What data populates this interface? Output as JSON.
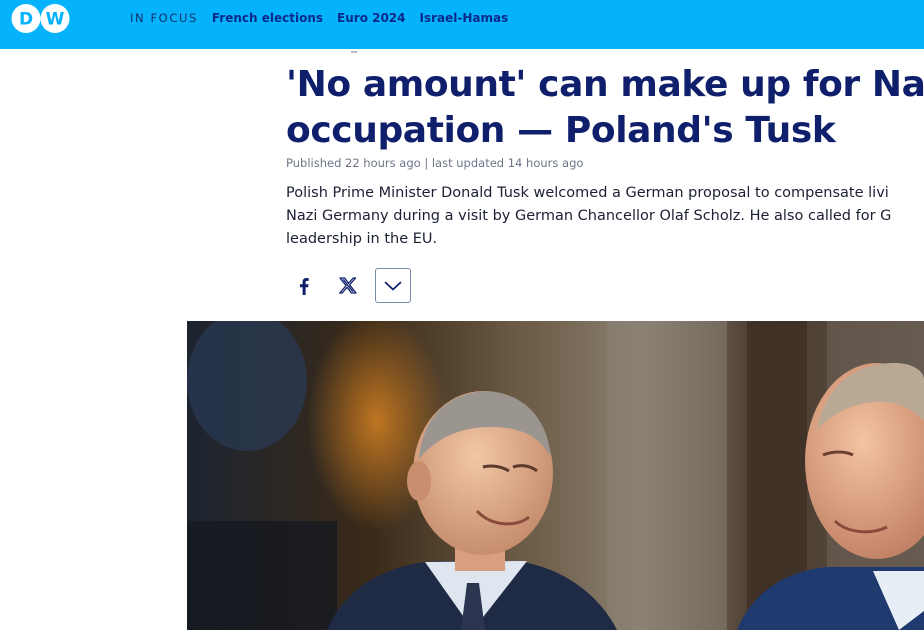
{
  "header": {
    "logo_text": "DW",
    "in_focus_label": "IN FOCUS",
    "nav_links": [
      "French elections",
      "Euro 2024",
      "Israel-Hamas"
    ],
    "bar_color": "#05b2fc"
  },
  "article": {
    "headline_line1": "'No amount' can make up for Nazi",
    "headline_line2": "occupation — Poland's Tusk",
    "meta": "Published 22 hours ago | last updated 14 hours ago",
    "teaser_line1": "Polish Prime Minister Donald Tusk welcomed a German proposal to compensate livi",
    "teaser_line2": "Nazi Germany during a visit by German Chancellor Olaf Scholz. He also called for G",
    "teaser_line3": "leadership in the EU.",
    "headline_color": "#0f1f6b"
  },
  "share": {
    "icons": [
      "facebook-icon",
      "x-icon",
      "chevron-down-icon"
    ]
  },
  "hero_image": {
    "description_icon": "photo"
  }
}
